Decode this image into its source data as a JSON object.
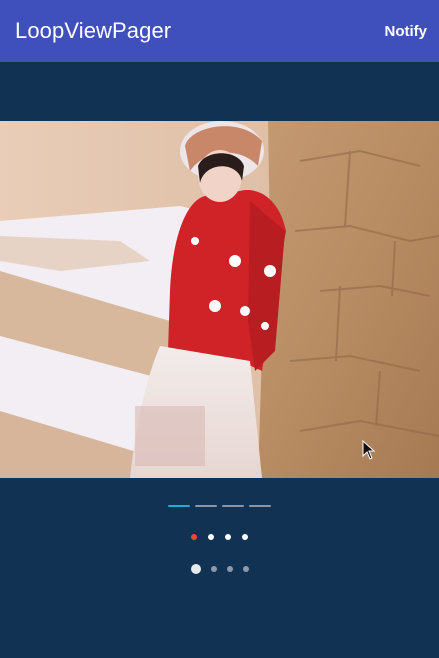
{
  "toolbar": {
    "title": "LoopViewPager",
    "action_label": "Notify"
  },
  "pager": {
    "current_index": 0,
    "page_count": 4
  },
  "indicators": {
    "line_style": {
      "active_index": 0,
      "count": 4,
      "active_color": "#28a8dc",
      "inactive_color": "#8a96a3"
    },
    "dot_style": {
      "active_index": 0,
      "count": 4,
      "active_color": "#f4433c",
      "inactive_color": "#ffffff"
    },
    "scale_style": {
      "active_index": 0,
      "count": 4,
      "active_color": "#e6e9ed",
      "inactive_color": "#8d9aa8"
    }
  },
  "colors": {
    "primary": "#3f4fbb",
    "background": "#113253"
  }
}
